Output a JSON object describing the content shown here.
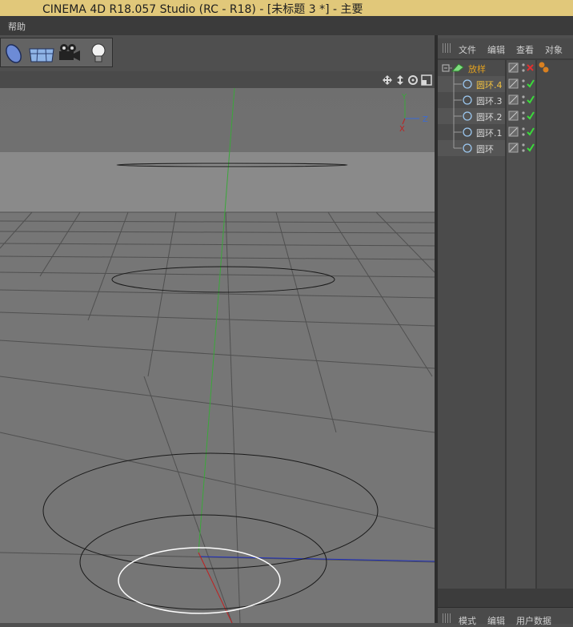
{
  "window": {
    "title": "CINEMA 4D R18.057 Studio (RC - R18) - [未标题 3 *] - 主要"
  },
  "menubar": {
    "help": "帮助"
  },
  "toolbar": {
    "icons": [
      "deformer-icon",
      "floor-icon",
      "camera-icon",
      "light-icon"
    ]
  },
  "viewport": {
    "nav_icons": [
      "move-view-icon",
      "zoom-view-icon",
      "rotate-view-icon",
      "maximize-view-icon"
    ],
    "axis_labels": {
      "y": "Y",
      "z": "Z",
      "x": "X"
    },
    "colors": {
      "background": "#767676",
      "horizon": "#8c8c8c",
      "y_axis": "#3aa83a",
      "z_axis": "#2030c0",
      "x_axis": "#c02020",
      "selected": "#ffffff"
    }
  },
  "object_manager": {
    "menu": [
      "文件",
      "编辑",
      "查看",
      "对象"
    ],
    "objects": [
      {
        "name": "放样",
        "type": "loft",
        "color": "#e0a020"
      },
      {
        "name": "圆环.4",
        "type": "circle",
        "color": "#f0c040"
      },
      {
        "name": "圆环.3",
        "type": "circle",
        "color": "#d6d6d6"
      },
      {
        "name": "圆环.2",
        "type": "circle",
        "color": "#d6d6d6"
      },
      {
        "name": "圆环.1",
        "type": "circle",
        "color": "#d6d6d6"
      },
      {
        "name": "圆环",
        "type": "circle",
        "color": "#d6d6d6"
      }
    ]
  },
  "attribute_manager": {
    "tabs": [
      "模式",
      "编辑",
      "用户数据"
    ]
  }
}
